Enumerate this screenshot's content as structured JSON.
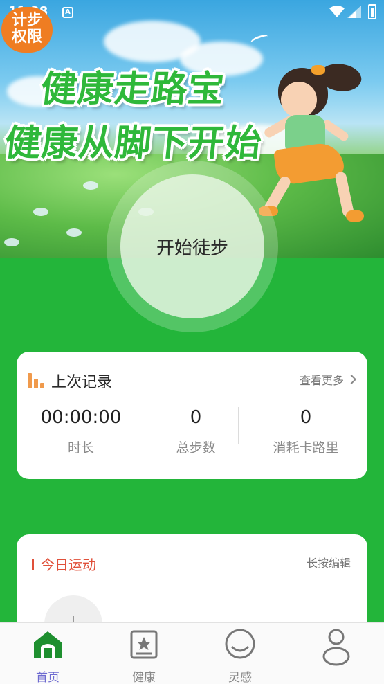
{
  "status_bar": {
    "time": "11:38",
    "notification_glyph": "A"
  },
  "hero": {
    "slogan_line1": "健康走路宝",
    "slogan_line2": "健康从脚下开始",
    "permission_badge": "计步\n权限",
    "start_button": "开始徒步"
  },
  "last_record": {
    "title": "上次记录",
    "more_label": "查看更多",
    "stats": [
      {
        "value": "00:00:00",
        "label": "时长"
      },
      {
        "value": "0",
        "label": "总步数"
      },
      {
        "value": "0",
        "label": "消耗卡路里"
      }
    ]
  },
  "today_sport": {
    "title": "今日运动",
    "edit_label": "长按编辑"
  },
  "bottom_nav": {
    "items": [
      {
        "label": "首页",
        "icon": "home-icon",
        "active": true
      },
      {
        "label": "健康",
        "icon": "health-star-icon",
        "active": false
      },
      {
        "label": "灵感",
        "icon": "smile-icon",
        "active": false
      },
      {
        "label": "",
        "icon": "profile-icon",
        "active": false
      }
    ]
  },
  "colors": {
    "primary_green": "#23b53a",
    "accent_orange": "#ef7d22",
    "today_red": "#e0503a",
    "active_nav": "#6d6ad0"
  }
}
